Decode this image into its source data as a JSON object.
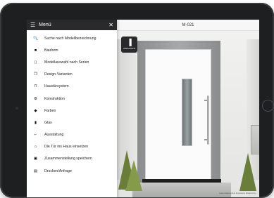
{
  "menu": {
    "title": "Menü",
    "items": [
      {
        "label": "Suche nach Modellbezeichnung",
        "icon": "search-icon",
        "glyph": "🔍"
      },
      {
        "label": "Bauform",
        "icon": "square-icon",
        "glyph": "■"
      },
      {
        "label": "Modellauswahl nach Serien",
        "icon": "door-outline-icon",
        "glyph": "▯"
      },
      {
        "label": "Design-Varianten",
        "icon": "copy-icon",
        "glyph": "❐"
      },
      {
        "label": "Haustürsystem",
        "icon": "frame-icon",
        "glyph": "⊓"
      },
      {
        "label": "Konstruktion",
        "icon": "gear-icon",
        "glyph": "⚙"
      },
      {
        "label": "Farben",
        "icon": "paint-bucket-icon",
        "glyph": "◆"
      },
      {
        "label": "Glas",
        "icon": "glass-pane-icon",
        "glyph": "▮"
      },
      {
        "label": "Ausstattung",
        "icon": "handle-icon",
        "glyph": "⌐"
      },
      {
        "label": "Die Tür ins Haus einsetzen",
        "icon": "house-icon",
        "glyph": "⌂"
      },
      {
        "label": "Zusammenstellung speichern",
        "icon": "save-icon",
        "glyph": "▣"
      },
      {
        "label": "Drucken/Anfrage",
        "icon": "print-icon",
        "glyph": "▤"
      }
    ]
  },
  "scene": {
    "model": "M-021",
    "view_button": "Außenansicht",
    "footer": "Laden   Datenschutz   Impressum   Powered by ..."
  },
  "colors": {
    "menu_header_bg": "#2a2a2c",
    "door": "#fbfbfb",
    "frame": "#9a9c9e"
  }
}
